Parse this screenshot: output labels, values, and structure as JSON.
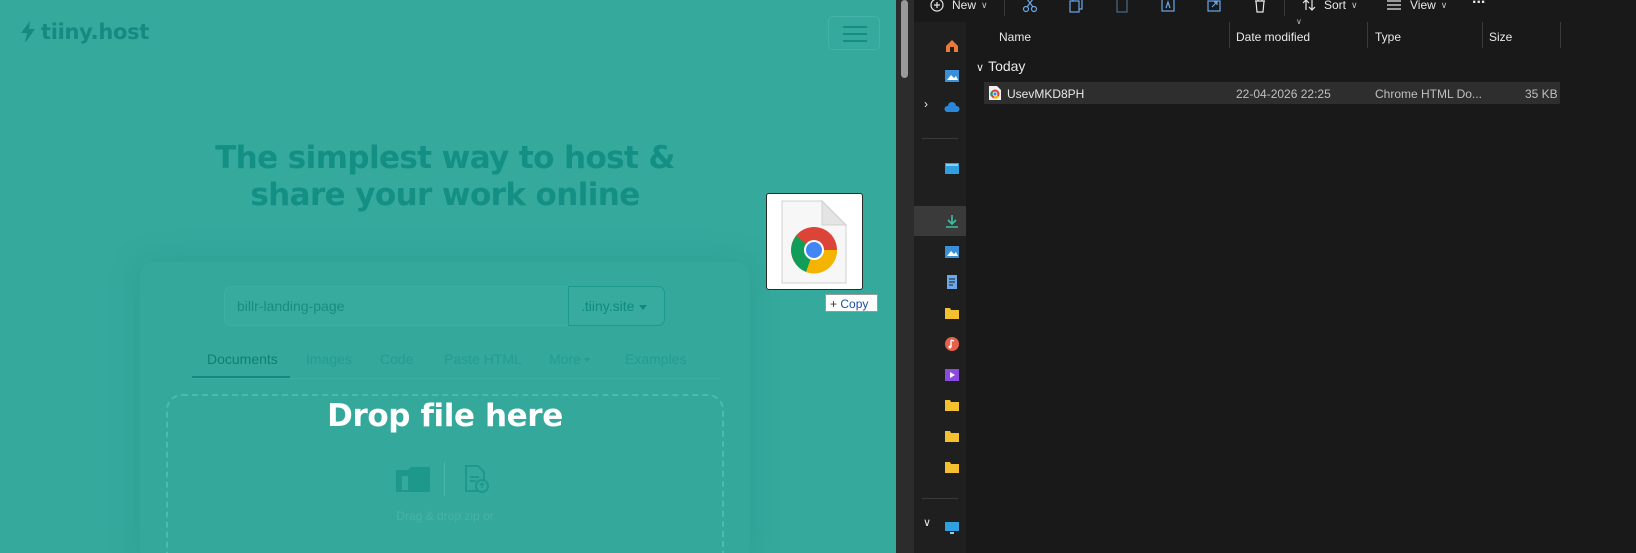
{
  "browser": {
    "logo_text": "tiiny.host",
    "headline_line1": "The simplest way to host &",
    "headline_line2": "share your work online",
    "domain_input_value": "billr-landing-page",
    "domain_suffix": ".tiiny.site",
    "tabs": [
      {
        "label": "Documents",
        "active": true
      },
      {
        "label": "Images"
      },
      {
        "label": "Code"
      },
      {
        "label": "Paste HTML"
      },
      {
        "label": "More"
      },
      {
        "label": "Examples"
      }
    ],
    "drop_title": "Drop file here",
    "drop_subtext": "Drag & drop zip or"
  },
  "drag": {
    "copy_label": "Copy",
    "icon": "chrome-html-file-icon"
  },
  "explorer": {
    "toolbar": {
      "new_label": "New",
      "sort_label": "Sort",
      "view_label": "View",
      "more_label": "..."
    },
    "columns": [
      "Name",
      "Date modified",
      "Type",
      "Size"
    ],
    "group_label": "Today",
    "files": [
      {
        "name": "UsevMKD8PH",
        "date": "22-04-2026 22:25",
        "type": "Chrome HTML Do...",
        "size": "35 KB"
      }
    ]
  },
  "colors": {
    "overlay_teal": "#35a99c",
    "explorer_bg": "#191919",
    "selected_row": "#2e2e2e"
  }
}
